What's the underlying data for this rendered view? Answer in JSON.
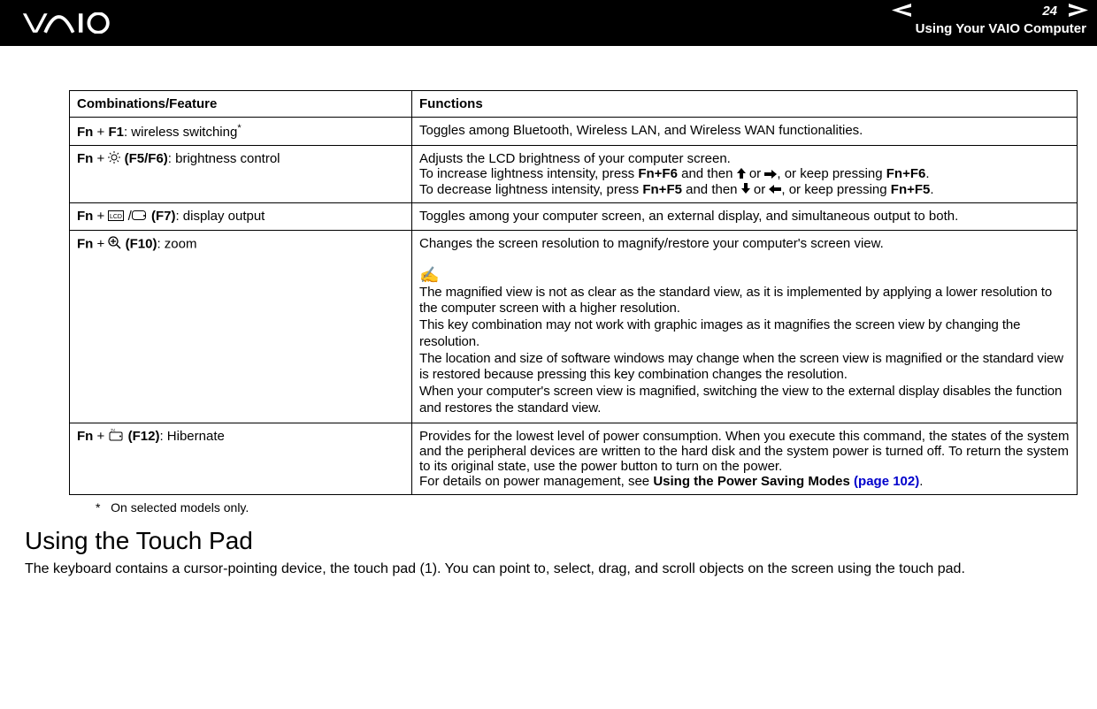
{
  "header": {
    "page_number": "24",
    "section": "Using Your VAIO Computer"
  },
  "table": {
    "headers": [
      "Combinations/Feature",
      "Functions"
    ],
    "rows": [
      {
        "combo_prefix": "Fn",
        "combo_plus": " + ",
        "combo_key": "F1",
        "combo_desc": ": wireless switching",
        "asterisk": "*",
        "func": "Toggles among Bluetooth, Wireless LAN, and Wireless WAN functionalities."
      },
      {
        "combo_prefix": "Fn",
        "combo_plus": " + ",
        "combo_key": "(F5/F6)",
        "combo_desc": ": brightness control",
        "func_line1": "Adjusts the LCD brightness of your computer screen.",
        "func_line2a": "To increase lightness intensity, press ",
        "func_line2b": "Fn+F6",
        "func_line2c": " and then ",
        "func_line2d": " or ",
        "func_line2e": ", or keep pressing ",
        "func_line2f": "Fn+F6",
        "func_line2g": ".",
        "func_line3a": "To decrease lightness intensity, press ",
        "func_line3b": "Fn+F5",
        "func_line3c": " and then ",
        "func_line3d": " or ",
        "func_line3e": ", or keep pressing ",
        "func_line3f": "Fn+F5",
        "func_line3g": "."
      },
      {
        "combo_prefix": "Fn",
        "combo_plus": " + ",
        "combo_key": "(F7)",
        "combo_desc": ": display output",
        "func": "Toggles among your computer screen, an external display, and simultaneous output to both."
      },
      {
        "combo_prefix": "Fn",
        "combo_plus": " + ",
        "combo_key": "(F10)",
        "combo_desc": ": zoom",
        "func_line1": "Changes the screen resolution to magnify/restore your computer's screen view.",
        "note_icon": "✍",
        "note1": "The magnified view is not as clear as the standard view, as it is implemented by applying a lower resolution to the computer screen with a higher resolution.",
        "note2": "This key combination may not work with graphic images as it magnifies the screen view by changing the resolution.",
        "note3": "The location and size of software windows may change when the screen view is magnified or the standard view is restored because pressing this key combination changes the resolution.",
        "note4": "When your computer's screen view is magnified, switching the view to the external display disables the function and restores the standard view."
      },
      {
        "combo_prefix": "Fn",
        "combo_plus": " + ",
        "combo_key": "(F12)",
        "combo_desc": ": Hibernate",
        "func_line1": "Provides for the lowest level of power consumption. When you execute this command, the states of the system and the peripheral devices are written to the hard disk and the system power is turned off. To return the system to its original state, use the power button to turn on the power.",
        "func_line2a": "For details on power management, see ",
        "func_line2b": "Using the Power Saving Modes ",
        "func_link": "(page 102)",
        "func_line2c": "."
      }
    ]
  },
  "footnote": {
    "mark": "*",
    "text": "On selected models only."
  },
  "heading": "Using the Touch Pad",
  "body": "The keyboard contains a cursor-pointing device, the touch pad (1). You can point to, select, drag, and scroll objects on the screen using the touch pad."
}
